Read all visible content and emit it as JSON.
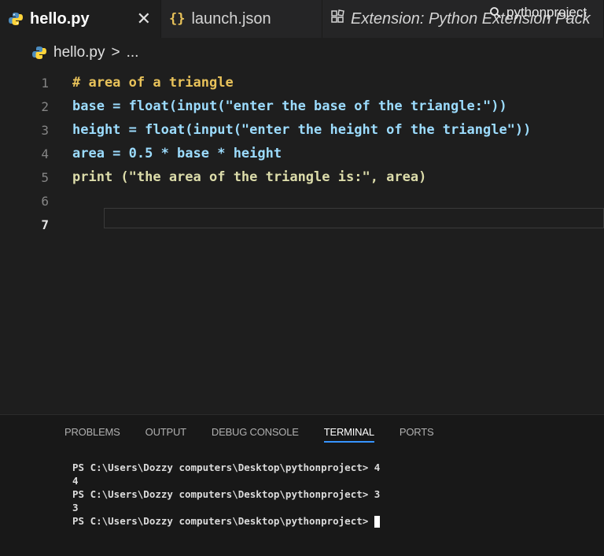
{
  "search": {
    "label": "pythonproject"
  },
  "tabs": [
    {
      "label": "hello.py",
      "active": true,
      "close": "✕"
    },
    {
      "label": "launch.json",
      "icon": "{}"
    },
    {
      "label": "Extension: Python Extension Pack"
    }
  ],
  "breadcrumb": {
    "file": "hello.py",
    "separator": ">",
    "more": "..."
  },
  "editor": {
    "lines": [
      {
        "n": "1",
        "text": "# area of a triangle"
      },
      {
        "n": "2",
        "text": "base = float(input(\"enter the base of the triangle:\"))"
      },
      {
        "n": "3",
        "text": "height = float(input(\"enter the height of the triangle\"))"
      },
      {
        "n": "4",
        "text": "area = 0.5 * base * height"
      },
      {
        "n": "5",
        "text": "print (\"the area of the triangle is:\", area)"
      },
      {
        "n": "6",
        "text": ""
      },
      {
        "n": "7",
        "text": ""
      }
    ]
  },
  "panel": {
    "tabs": [
      "PROBLEMS",
      "OUTPUT",
      "DEBUG CONSOLE",
      "TERMINAL",
      "PORTS"
    ],
    "active_tab": "TERMINAL"
  },
  "terminal": {
    "lines": [
      "PS C:\\Users\\Dozzy computers\\Desktop\\pythonproject> 4",
      "4",
      "PS C:\\Users\\Dozzy computers\\Desktop\\pythonproject> 3",
      "3",
      "PS C:\\Users\\Dozzy computers\\Desktop\\pythonproject> "
    ]
  },
  "colors": {
    "accent": "#3794ff",
    "comment": "#e8c25a",
    "background": "#1e1e1e"
  }
}
